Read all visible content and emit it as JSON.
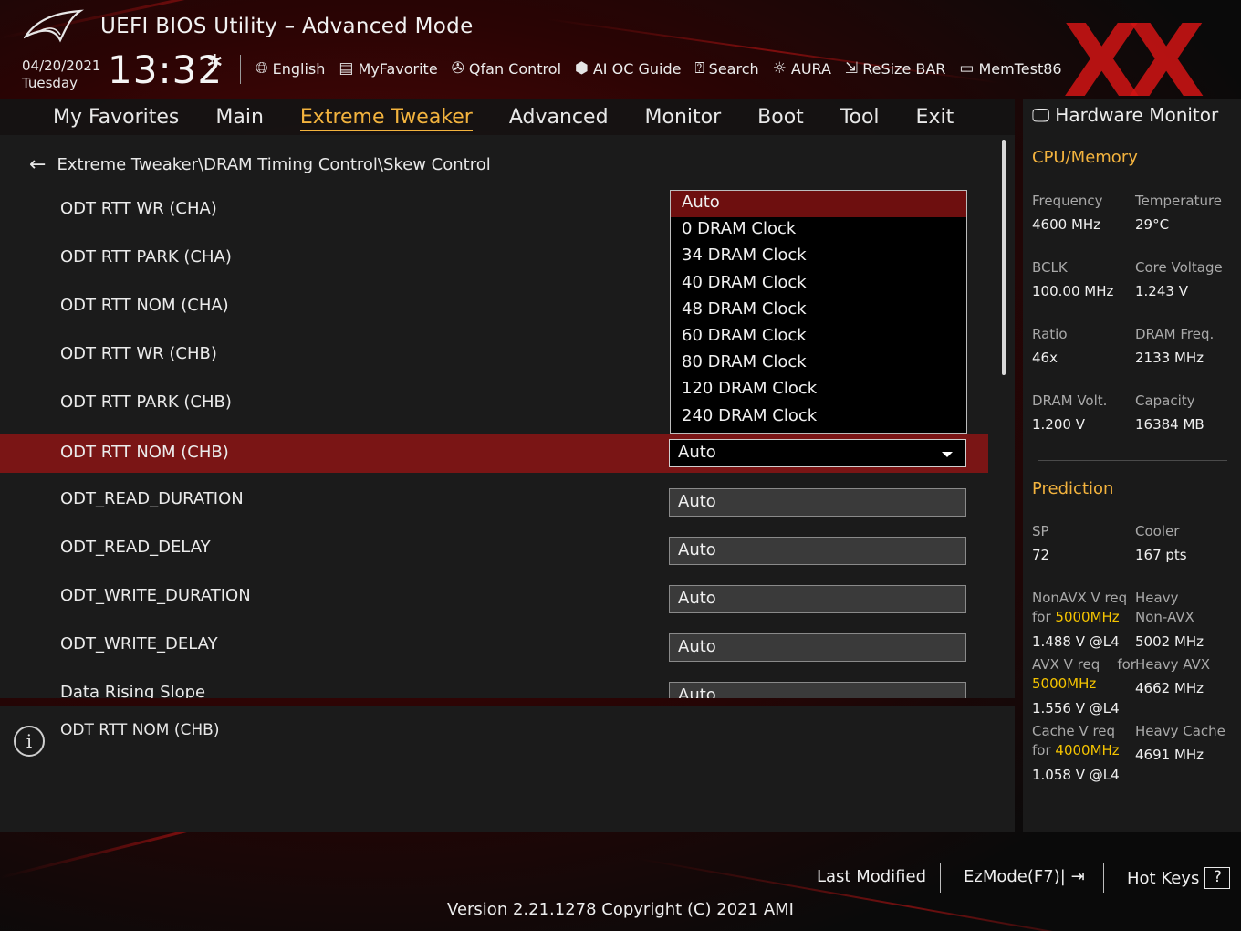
{
  "window": {
    "title": "UEFI BIOS Utility – Advanced Mode"
  },
  "header": {
    "date": "04/20/2021",
    "day": "Tuesday",
    "time": "13:32",
    "toolbar": [
      {
        "label": "English",
        "icon": "globe-icon"
      },
      {
        "label": "MyFavorite",
        "icon": "favorite-icon"
      },
      {
        "label": "Qfan Control",
        "icon": "fan-icon"
      },
      {
        "label": "AI OC Guide",
        "icon": "ai-guide-icon"
      },
      {
        "label": "Search",
        "icon": "search-icon"
      },
      {
        "label": "AURA",
        "icon": "aura-icon"
      },
      {
        "label": "ReSize BAR",
        "icon": "resize-bar-icon"
      },
      {
        "label": "MemTest86",
        "icon": "memtest-icon"
      }
    ]
  },
  "tabs": [
    {
      "label": "My Favorites",
      "active": false
    },
    {
      "label": "Main",
      "active": false
    },
    {
      "label": "Extreme Tweaker",
      "active": true
    },
    {
      "label": "Advanced",
      "active": false
    },
    {
      "label": "Monitor",
      "active": false
    },
    {
      "label": "Boot",
      "active": false
    },
    {
      "label": "Tool",
      "active": false
    },
    {
      "label": "Exit",
      "active": false
    }
  ],
  "breadcrumb": "Extreme Tweaker\\DRAM Timing Control\\Skew Control",
  "settings": [
    {
      "label": "ODT RTT WR (CHA)",
      "value": ""
    },
    {
      "label": "ODT RTT PARK (CHA)",
      "value": ""
    },
    {
      "label": "ODT RTT NOM (CHA)",
      "value": ""
    },
    {
      "label": "ODT RTT WR (CHB)",
      "value": ""
    },
    {
      "label": "ODT RTT PARK (CHB)",
      "value": ""
    },
    {
      "label": "ODT RTT NOM (CHB)",
      "value": "Auto",
      "selected": true
    },
    {
      "label": "ODT_READ_DURATION",
      "value": "Auto"
    },
    {
      "label": "ODT_READ_DELAY",
      "value": "Auto"
    },
    {
      "label": "ODT_WRITE_DURATION",
      "value": "Auto"
    },
    {
      "label": "ODT_WRITE_DELAY",
      "value": "Auto"
    },
    {
      "label": "Data Rising Slope",
      "value": "Auto"
    }
  ],
  "dropdown": {
    "options": [
      "Auto",
      "0 DRAM Clock",
      "34 DRAM Clock",
      "40 DRAM Clock",
      "48 DRAM Clock",
      "60 DRAM Clock",
      "80 DRAM Clock",
      "120 DRAM Clock",
      "240 DRAM Clock"
    ],
    "highlighted": "Auto"
  },
  "help": {
    "text": "ODT RTT NOM (CHB)"
  },
  "hardware_monitor": {
    "title": "Hardware Monitor",
    "cpu_memory": {
      "heading": "CPU/Memory",
      "items": [
        {
          "label": "Frequency",
          "value": "4600 MHz"
        },
        {
          "label": "Temperature",
          "value": "29°C"
        },
        {
          "label": "BCLK",
          "value": "100.00 MHz"
        },
        {
          "label": "Core Voltage",
          "value": "1.243 V"
        },
        {
          "label": "Ratio",
          "value": "46x"
        },
        {
          "label": "DRAM Freq.",
          "value": "2133 MHz"
        },
        {
          "label": "DRAM Volt.",
          "value": "1.200 V"
        },
        {
          "label": "Capacity",
          "value": "16384 MB"
        }
      ]
    },
    "prediction": {
      "heading": "Prediction",
      "sp_label": "SP",
      "sp_value": "72",
      "cooler_label": "Cooler",
      "cooler_value": "167 pts",
      "nonavx_label": "NonAVX V req",
      "nonavx_for": "for",
      "nonavx_freq": "5000MHz",
      "nonavx_value": "1.488 V @L4",
      "heavy_nonavx_label1": "Heavy",
      "heavy_nonavx_label2": "Non-AVX",
      "heavy_nonavx_value": "5002 MHz",
      "avx_label": "AVX V req",
      "avx_for": "for",
      "avx_freq": "5000MHz",
      "avx_value": "1.556 V @L4",
      "heavy_avx_label": "Heavy AVX",
      "heavy_avx_value": "4662 MHz",
      "cache_label": "Cache V req",
      "cache_for": "for",
      "cache_freq": "4000MHz",
      "cache_value": "1.058 V @L4",
      "heavy_cache_label": "Heavy Cache",
      "heavy_cache_value": "4691 MHz"
    }
  },
  "footer": {
    "last_modified": "Last Modified",
    "ezmode": "EzMode(F7)|",
    "hotkeys": "Hot Keys",
    "hotkeys_key": "?",
    "version": "Version 2.21.1278 Copyright (C) 2021 AMI"
  },
  "colors": {
    "accent": "#f3b33e",
    "selected_row": "#7a1515",
    "highlight_option": "#6e0f0f",
    "yellow_text": "#f5c400"
  }
}
